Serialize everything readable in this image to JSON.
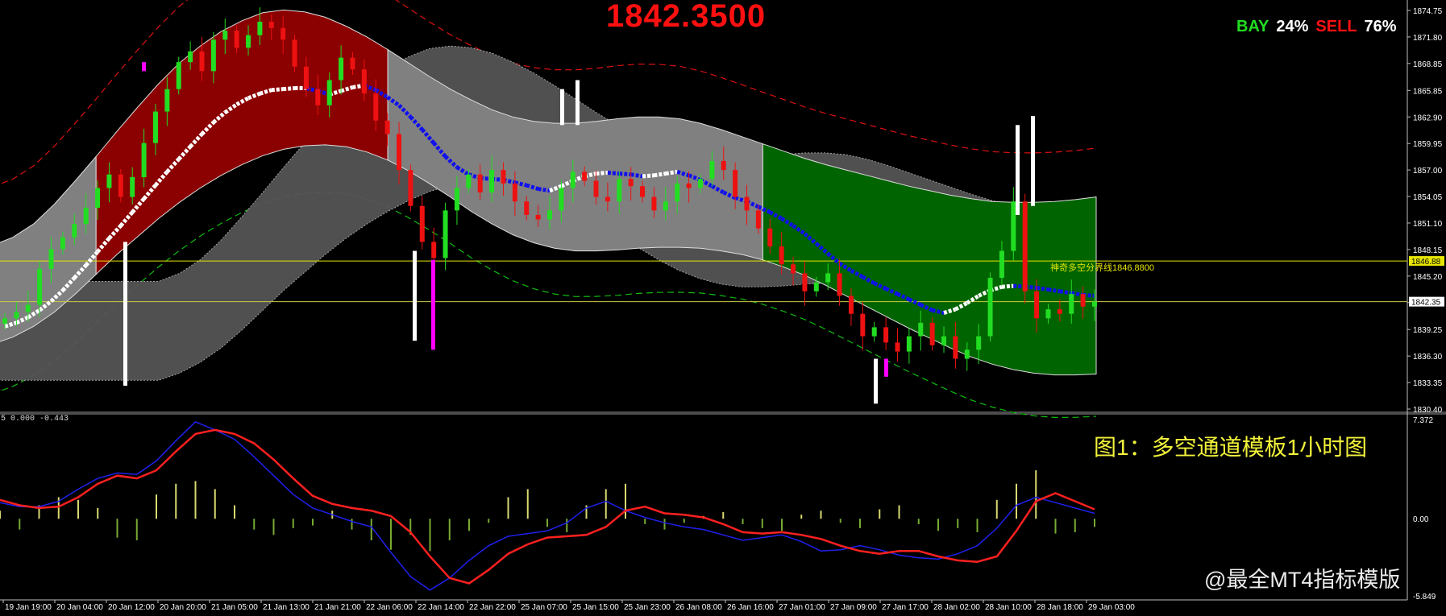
{
  "header": {
    "current_price": "1842.3500",
    "buy_label": "BAY",
    "buy_pct": "24%",
    "sell_label": "SELL",
    "sell_pct": "76%"
  },
  "caption": "图1：多空通道模板1小时图",
  "watermark": "@最全MT4指标模版",
  "indicator_header": "5 0.000 -0.443",
  "colors": {
    "bull_candle": "#22dd22",
    "bear_candle": "#ee1111",
    "red_zone": "#8b0000",
    "green_zone": "#006400",
    "gray_zone": "#808080",
    "mid_line_blue": "#1010ee",
    "mid_line_white": "#ffffff",
    "macd_main": "#ff2020",
    "macd_signal": "#2020ee",
    "histogram": "#cccc66"
  },
  "chart_data": [
    {
      "type": "line",
      "instrument_hint": "candlestick price chart",
      "x_tick_labels": [
        "19 Jan 19:00",
        "20 Jan 04:00",
        "20 Jan 12:00",
        "20 Jan 20:00",
        "21 Jan 05:00",
        "21 Jan 13:00",
        "21 Jan 21:00",
        "22 Jan 06:00",
        "22 Jan 14:00",
        "22 Jan 22:00",
        "25 Jan 07:00",
        "25 Jan 15:00",
        "25 Jan 23:00",
        "26 Jan 08:00",
        "26 Jan 16:00",
        "27 Jan 01:00",
        "27 Jan 09:00",
        "27 Jan 17:00",
        "28 Jan 02:00",
        "28 Jan 10:00",
        "28 Jan 18:00",
        "29 Jan 03:00"
      ],
      "y_tick_labels": [
        "1874.75",
        "1871.80",
        "1868.85",
        "1865.85",
        "1862.90",
        "1859.95",
        "1857.00",
        "1854.05",
        "1851.10",
        "1848.15",
        "1845.20",
        "1842.25",
        "1839.25",
        "1836.30",
        "1833.35",
        "1830.40"
      ],
      "ylim": [
        1830.4,
        1874.75
      ],
      "price_tags": [
        "1846.88",
        "1842.35"
      ],
      "divider_label": "神奇多空分界线1846.8800",
      "divider_value": 1846.88,
      "current_value": 1842.35,
      "close": [
        1840.5,
        1841.2,
        1842.0,
        1846.0,
        1848.2,
        1849.5,
        1851.0,
        1852.8,
        1855.0,
        1856.5,
        1854.0,
        1856.2,
        1860.0,
        1863.5,
        1866.0,
        1869.0,
        1870.2,
        1868.0,
        1871.5,
        1872.5,
        1870.6,
        1872.0,
        1873.5,
        1872.8,
        1871.5,
        1868.5,
        1866.0,
        1864.2,
        1867.0,
        1869.5,
        1868.2,
        1865.5,
        1862.5,
        1861.0,
        1857.0,
        1853.0,
        1849.0,
        1847.2,
        1852.5,
        1855.0,
        1856.5,
        1854.5,
        1857.0,
        1855.5,
        1853.5,
        1852.0,
        1851.5,
        1852.5,
        1855.0,
        1856.8,
        1855.8,
        1854.0,
        1853.5,
        1856.0,
        1855.2,
        1854.0,
        1852.5,
        1853.5,
        1855.5,
        1855.0,
        1856.0,
        1858.0,
        1857.0,
        1854.0,
        1852.5,
        1850.5,
        1848.5,
        1846.5,
        1845.5,
        1843.5,
        1844.5,
        1845.5,
        1843.0,
        1841.0,
        1838.5,
        1839.5,
        1837.8,
        1836.8,
        1838.5,
        1840.0,
        1837.5,
        1838.5,
        1836.0,
        1837.0,
        1838.5,
        1845.0,
        1848.0,
        1853.5,
        1843.5,
        1840.5,
        1841.5,
        1841.0,
        1843.2,
        1841.8,
        1842.35
      ],
      "mid_line": [
        1839.6,
        1840.0,
        1840.6,
        1841.4,
        1842.4,
        1843.6,
        1845.0,
        1846.4,
        1847.9,
        1849.4,
        1850.8,
        1852.3,
        1853.8,
        1855.3,
        1856.8,
        1858.2,
        1859.6,
        1861.0,
        1862.3,
        1863.4,
        1864.3,
        1865.0,
        1865.5,
        1865.9,
        1866.0,
        1866.1,
        1866.1,
        1865.8,
        1865.4,
        1865.8,
        1866.2,
        1866.4,
        1865.9,
        1865.1,
        1864.2,
        1862.9,
        1861.5,
        1860.0,
        1858.5,
        1857.3,
        1856.5,
        1856.1,
        1856.0,
        1855.9,
        1855.6,
        1855.3,
        1854.9,
        1854.7,
        1855.2,
        1855.8,
        1856.3,
        1856.6,
        1856.7,
        1856.6,
        1856.5,
        1856.3,
        1856.4,
        1856.6,
        1856.8,
        1856.4,
        1855.9,
        1855.2,
        1854.5,
        1853.9,
        1853.5,
        1852.9,
        1852.3,
        1851.6,
        1850.8,
        1849.9,
        1848.8,
        1847.7,
        1846.6,
        1845.8,
        1845.1,
        1844.4,
        1843.8,
        1843.2,
        1842.6,
        1842.0,
        1841.4,
        1841.1,
        1841.5,
        1842.2,
        1843.0,
        1843.6,
        1844.0,
        1844.1,
        1844.0,
        1843.9,
        1843.7,
        1843.5,
        1843.3,
        1843.1,
        1843.0
      ],
      "upper_band": [
        1848.6,
        1849.5,
        1851.0,
        1853.2,
        1855.8,
        1858.5,
        1861.3,
        1864.0,
        1866.6,
        1868.9,
        1870.8,
        1872.4,
        1873.6,
        1874.5,
        1874.8,
        1874.6,
        1874.0,
        1873.0,
        1871.8,
        1870.4,
        1868.9,
        1867.4,
        1866.0,
        1864.8,
        1863.7,
        1862.9,
        1862.4,
        1862.2,
        1862.2,
        1862.4,
        1862.7,
        1862.9,
        1862.9,
        1862.7,
        1862.2,
        1861.5,
        1860.7,
        1859.9,
        1859.1,
        1858.3,
        1857.6,
        1857.0,
        1856.4,
        1855.8,
        1855.2,
        1854.7,
        1854.2,
        1853.8,
        1853.5,
        1853.4,
        1853.4,
        1853.5,
        1853.7,
        1854.0
      ],
      "lower_band": [
        1837.6,
        1838.4,
        1839.6,
        1841.2,
        1843.2,
        1845.4,
        1847.6,
        1849.6,
        1851.6,
        1853.4,
        1855.0,
        1856.4,
        1857.6,
        1858.6,
        1859.3,
        1859.7,
        1859.8,
        1859.6,
        1859.0,
        1858.1,
        1856.9,
        1855.5,
        1854.0,
        1852.4,
        1851.0,
        1849.8,
        1848.9,
        1848.3,
        1848.0,
        1848.0,
        1848.1,
        1848.3,
        1848.4,
        1848.4,
        1848.3,
        1848.0,
        1847.6,
        1847.0,
        1846.2,
        1845.3,
        1844.2,
        1843.0,
        1841.8,
        1840.6,
        1839.4,
        1838.3,
        1837.2,
        1836.2,
        1835.4,
        1834.8,
        1834.4,
        1834.2,
        1834.2,
        1834.3
      ]
    },
    {
      "type": "line",
      "indicator": "MACD-style oscillator",
      "ylim": [
        -5.849,
        7.372
      ],
      "y_tick_labels": [
        "7.372",
        "0.00",
        "-5.849"
      ],
      "main": [
        1.4,
        1.0,
        0.8,
        0.9,
        1.6,
        2.6,
        3.2,
        3.0,
        3.6,
        5.0,
        6.3,
        6.6,
        6.3,
        5.6,
        4.4,
        3.0,
        1.7,
        1.1,
        0.8,
        0.6,
        0.2,
        -1.0,
        -2.8,
        -4.4,
        -4.8,
        -3.8,
        -2.6,
        -1.9,
        -1.4,
        -1.3,
        -1.2,
        -0.6,
        0.6,
        0.9,
        0.4,
        0.3,
        0.1,
        -0.4,
        -1.0,
        -1.1,
        -1.0,
        -1.2,
        -1.5,
        -2.0,
        -2.4,
        -2.6,
        -2.4,
        -2.4,
        -2.8,
        -3.1,
        -3.2,
        -2.8,
        -0.9,
        1.3,
        1.9,
        1.3,
        0.7
      ],
      "signal": [
        1.2,
        0.9,
        0.9,
        1.3,
        2.2,
        3.0,
        3.4,
        3.3,
        4.3,
        5.8,
        7.2,
        6.6,
        5.9,
        4.6,
        3.2,
        1.8,
        0.8,
        0.3,
        -0.2,
        -0.6,
        -2.5,
        -4.3,
        -5.3,
        -4.4,
        -3.1,
        -2.0,
        -1.3,
        -1.1,
        -0.9,
        -0.3,
        0.8,
        1.3,
        0.6,
        0.1,
        -0.3,
        -0.6,
        -0.8,
        -1.2,
        -1.6,
        -1.4,
        -1.2,
        -1.7,
        -2.4,
        -2.3,
        -2.0,
        -2.3,
        -2.7,
        -2.9,
        -3.0,
        -2.6,
        -2.0,
        -0.7,
        1.0,
        1.6,
        1.2,
        0.8,
        0.4
      ],
      "histogram": [
        0.6,
        -0.8,
        1.0,
        1.6,
        1.4,
        0.8,
        -1.4,
        -1.6,
        1.8,
        2.6,
        2.8,
        2.2,
        1.0,
        -0.8,
        -1.2,
        -0.7,
        -0.5,
        0.6,
        -0.8,
        -1.6,
        -2.3,
        -1.2,
        -2.4,
        -1.6,
        -0.9,
        -0.3,
        1.6,
        2.2,
        -0.6,
        -1.0,
        1.0,
        2.2,
        2.6,
        -0.4,
        -0.8,
        -0.3,
        0.2,
        0.5,
        -0.4,
        -0.7,
        -0.9,
        0.3,
        0.6,
        -0.3,
        -0.7,
        0.7,
        1.0,
        -0.4,
        -0.9,
        -0.7,
        -1.0,
        1.4,
        2.6,
        3.6,
        -1.1,
        -1.0,
        -0.6
      ]
    }
  ]
}
